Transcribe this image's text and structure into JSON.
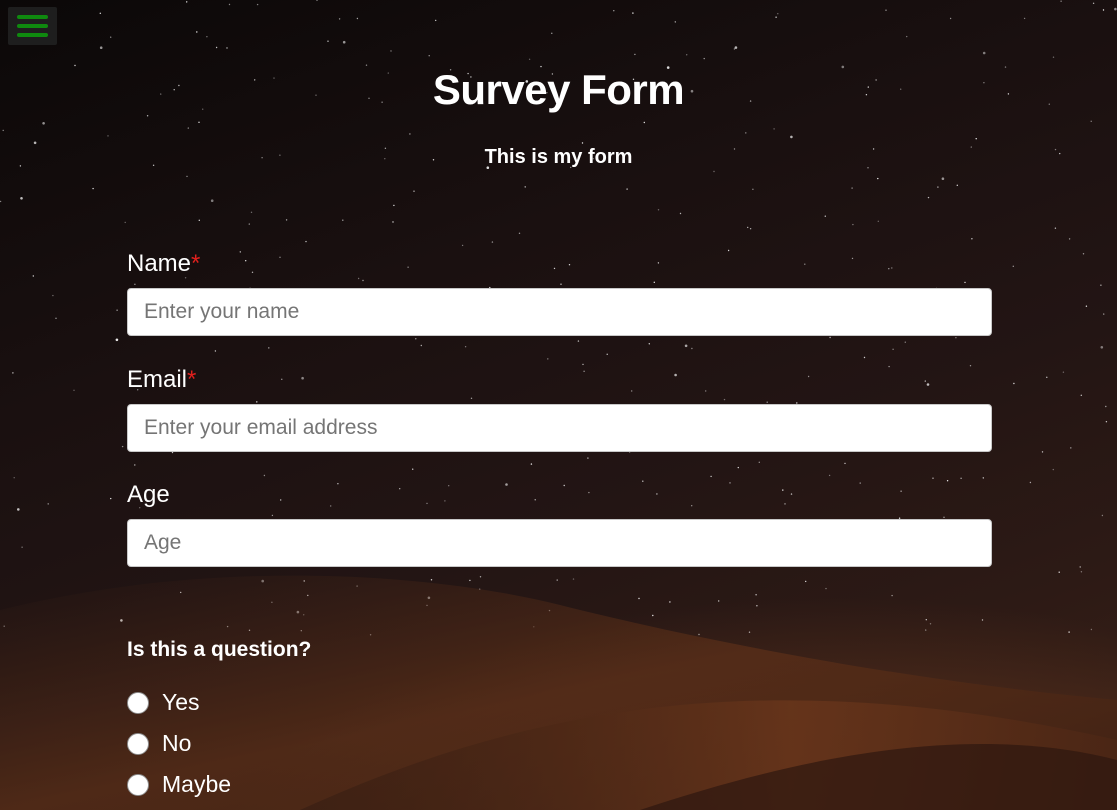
{
  "menu": {
    "icon": "hamburger-menu-icon",
    "color": "#0f8a0f"
  },
  "header": {
    "title": "Survey Form",
    "description": "This is my form"
  },
  "form": {
    "name": {
      "label": "Name",
      "required_mark": "*",
      "placeholder": "Enter your name",
      "value": ""
    },
    "email": {
      "label": "Email",
      "required_mark": "*",
      "placeholder": "Enter your email address",
      "value": ""
    },
    "age": {
      "label": "Age",
      "placeholder": "Age",
      "value": ""
    },
    "question": {
      "label": "Is this a question?",
      "options": [
        {
          "label": "Yes",
          "selected": false
        },
        {
          "label": "No",
          "selected": false
        },
        {
          "label": "Maybe",
          "selected": false
        }
      ]
    }
  },
  "colors": {
    "required": "#e0201d",
    "text": "#ffffff",
    "input_background": "#ffffff"
  }
}
